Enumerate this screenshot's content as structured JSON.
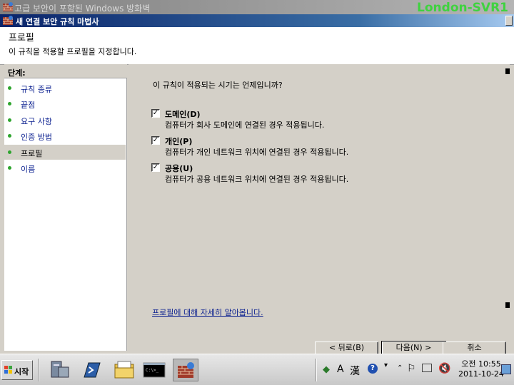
{
  "background_window": {
    "title": "고급 보안이 포함된 Windows 방화벽"
  },
  "watermark": "London-SVR1",
  "wizard": {
    "title": "새 연결 보안 규칙 마법사",
    "header_title": "프로필",
    "header_desc": "이 규칙을 적용할 프로필을 지정합니다."
  },
  "sidebar": {
    "steps_label": "단계:",
    "items": [
      {
        "label": "규칙 종류"
      },
      {
        "label": "끝점"
      },
      {
        "label": "요구 사항"
      },
      {
        "label": "인증 방법"
      },
      {
        "label": "프로필",
        "active": true
      },
      {
        "label": "이름"
      }
    ]
  },
  "content": {
    "question": "이 규칙이 적용되는 시기는 언제입니까?",
    "options": [
      {
        "name": "도메인(D)",
        "desc": "컴퓨터가 회사 도메인에 연결된 경우 적용됩니다.",
        "checked": true
      },
      {
        "name": "개인(P)",
        "desc": "컴퓨터가 개인 네트워크 위치에 연결된 경우 적용됩니다.",
        "checked": true
      },
      {
        "name": "공용(U)",
        "desc": "컴퓨터가 공용 네트워크 위치에 연결된 경우 적용됩니다.",
        "checked": true
      }
    ],
    "check_mark": "✓",
    "learn_link": "프로필에 대해 자세히 알아봅니다."
  },
  "buttons": {
    "back": "< 뒤로(B)",
    "next": "다음(N) >",
    "cancel": "취소"
  },
  "taskbar": {
    "start_label": "시작",
    "clock_time": "오전 10:55",
    "clock_date": "2011-10-24",
    "ime_a": "A",
    "ime_han": "漢"
  },
  "colors": {
    "title_bar_active": "#0a246a",
    "link": "#0a1f8f",
    "step_dot": "#2ea52e",
    "watermark": "#3fd23f"
  }
}
